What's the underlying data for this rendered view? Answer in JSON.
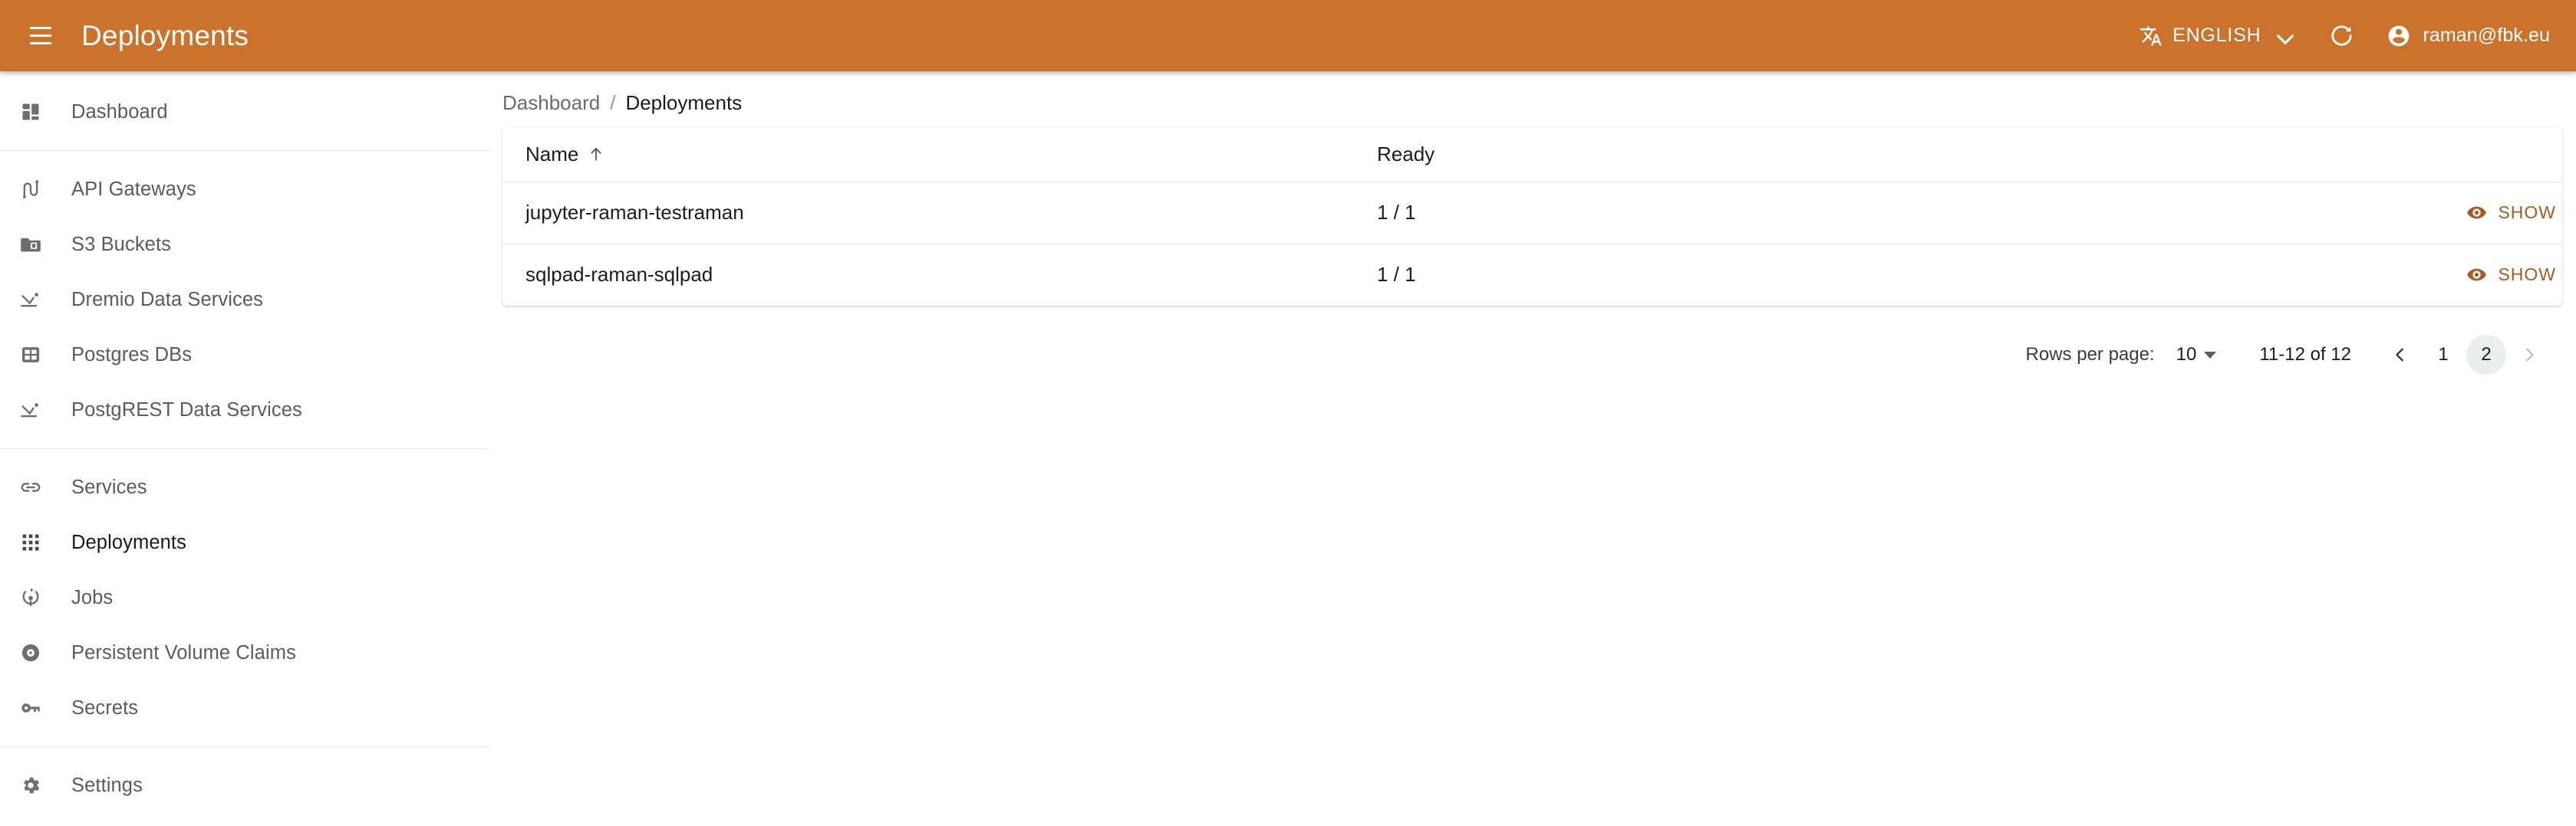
{
  "appbar": {
    "title": "Deployments",
    "menu_icon": "hamburger-menu-icon",
    "language": {
      "icon": "translate-icon",
      "label": "ENGLISH",
      "chevron": "chevron-down-icon"
    },
    "refresh_icon": "refresh-icon",
    "account": {
      "avatar_icon": "account-circle-icon",
      "email": "raman@fbk.eu"
    },
    "background_color": "#cb732c",
    "text_color": "#ffffff"
  },
  "sidebar": {
    "groups": [
      {
        "items": [
          {
            "label": "Dashboard",
            "icon": "dashboard-icon",
            "selected": false
          }
        ]
      },
      {
        "items": [
          {
            "label": "API Gateways",
            "icon": "api-gateway-icon",
            "selected": false
          },
          {
            "label": "S3 Buckets",
            "icon": "s3-bucket-folder-icon",
            "selected": false
          },
          {
            "label": "Dremio Data Services",
            "icon": "data-service-icon",
            "selected": false
          },
          {
            "label": "Postgres DBs",
            "icon": "database-grid-icon",
            "selected": false
          },
          {
            "label": "PostgREST Data Services",
            "icon": "data-service-icon",
            "selected": false
          }
        ]
      },
      {
        "items": [
          {
            "label": "Services",
            "icon": "link-icon",
            "selected": false
          },
          {
            "label": "Deployments",
            "icon": "apps-grid-icon",
            "selected": true
          },
          {
            "label": "Jobs",
            "icon": "jobs-rotate-icon",
            "selected": false
          },
          {
            "label": "Persistent Volume Claims",
            "icon": "storage-disk-icon",
            "selected": false
          },
          {
            "label": "Secrets",
            "icon": "key-icon",
            "selected": false
          }
        ]
      },
      {
        "items": [
          {
            "label": "Settings",
            "icon": "gear-icon",
            "selected": false
          }
        ]
      }
    ]
  },
  "breadcrumb": {
    "root": "Dashboard",
    "separator": "/",
    "current": "Deployments"
  },
  "table": {
    "columns": [
      {
        "key": "name",
        "label": "Name",
        "sorted": "asc",
        "sort_icon": "arrow-up-icon"
      },
      {
        "key": "ready",
        "label": "Ready",
        "sorted": null
      },
      {
        "key": "action",
        "label": "",
        "sorted": null
      }
    ],
    "rows": [
      {
        "name": "jupyter-raman-testraman",
        "ready": "1 / 1",
        "action_label": "SHOW",
        "action_icon": "eye-icon"
      },
      {
        "name": "sqlpad-raman-sqlpad",
        "ready": "1 / 1",
        "action_label": "SHOW",
        "action_icon": "eye-icon"
      }
    ],
    "action_color": "#a85a22"
  },
  "pagination": {
    "rows_per_page_label": "Rows per page:",
    "rows_per_page_value": "10",
    "rows_per_page_caret": "caret-down-icon",
    "range_text": "11-12 of 12",
    "prev_icon": "chevron-left-icon",
    "next_icon": "chevron-right-icon",
    "pages": [
      "1",
      "2"
    ],
    "current_page": "2",
    "prev_enabled": true,
    "next_enabled": false
  }
}
